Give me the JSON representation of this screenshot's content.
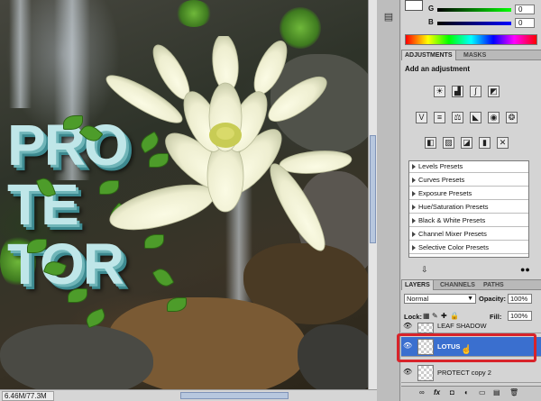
{
  "status": {
    "doc_size": "6.46M/77.3M"
  },
  "colors": {
    "g_value": "0",
    "b_value": "0",
    "g_label": "G",
    "b_label": "B"
  },
  "adjustments": {
    "tabs": [
      "ADJUSTMENTS",
      "MASKS"
    ],
    "title": "Add an adjustment",
    "presets": [
      "Levels Presets",
      "Curves Presets",
      "Exposure Presets",
      "Hue/Saturation Presets",
      "Black & White Presets",
      "Channel Mixer Presets",
      "Selective Color Presets"
    ]
  },
  "layers_panel": {
    "tabs": [
      "LAYERS",
      "CHANNELS",
      "PATHS"
    ],
    "blend_mode": "Normal",
    "opacity_label": "Opacity:",
    "opacity_value": "100%",
    "lock_label": "Lock:",
    "fill_label": "Fill:",
    "fill_value": "100%",
    "layers": [
      {
        "name": "LEAF SHADOW",
        "selected": false
      },
      {
        "name": "LOTUS",
        "selected": true
      },
      {
        "name": "PROTECT copy 2",
        "selected": false
      }
    ],
    "bottom_icons": [
      "∞",
      "fx",
      "◘",
      "◐",
      "▭",
      "▤",
      "🗑"
    ]
  },
  "canvas": {
    "logo_text": "PRO\nTE\nTOR"
  },
  "accent": {
    "selected_layer": "#3a6fcf",
    "highlight": "#d8232a"
  }
}
